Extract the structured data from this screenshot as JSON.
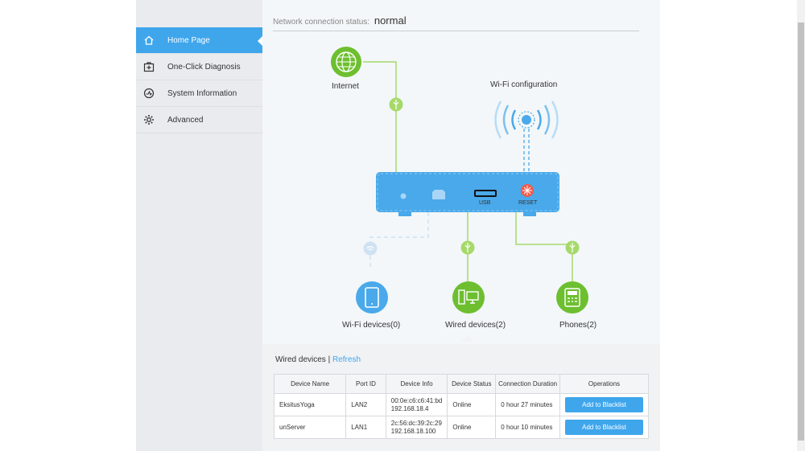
{
  "sidebar": {
    "items": [
      {
        "label": "Home Page",
        "icon": "home-icon",
        "active": true
      },
      {
        "label": "One-Click Diagnosis",
        "icon": "first-aid-icon",
        "active": false
      },
      {
        "label": "System Information",
        "icon": "gauge-icon",
        "active": false
      },
      {
        "label": "Advanced",
        "icon": "gear-icon",
        "active": false
      }
    ]
  },
  "status": {
    "label": "Network connection status:",
    "value": "normal"
  },
  "diagram": {
    "internet_label": "Internet",
    "wifi_config_label": "Wi-Fi configuration",
    "usb_label": "USB",
    "reset_label": "RESET",
    "wifi_devices_label": "Wi-Fi devices(0)",
    "wired_devices_label": "Wired devices(2)",
    "phones_label": "Phones(2)"
  },
  "devices_panel": {
    "title": "Wired devices",
    "separator": "|",
    "refresh_label": "Refresh",
    "columns": [
      "Device Name",
      "Port ID",
      "Device Info",
      "Device Status",
      "Connection Duration",
      "Operations"
    ],
    "rows": [
      {
        "name": "EksitusYoga",
        "port": "LAN2",
        "mac": "00:0e:c6:c6:41:bd",
        "ip": "192.168.18.4",
        "status": "Online",
        "duration": "0 hour 27 minutes",
        "action": "Add to Blacklist"
      },
      {
        "name": "unServer",
        "port": "LAN1",
        "mac": "2c:56:dc:39:2c:29",
        "ip": "192.168.18.100",
        "status": "Online",
        "duration": "0 hour 10 minutes",
        "action": "Add to Blacklist"
      }
    ]
  },
  "colors": {
    "accent": "#3fa6ec",
    "green": "#6dbf2f",
    "router": "#4aa9ea",
    "reset_red": "#f15a4a"
  }
}
